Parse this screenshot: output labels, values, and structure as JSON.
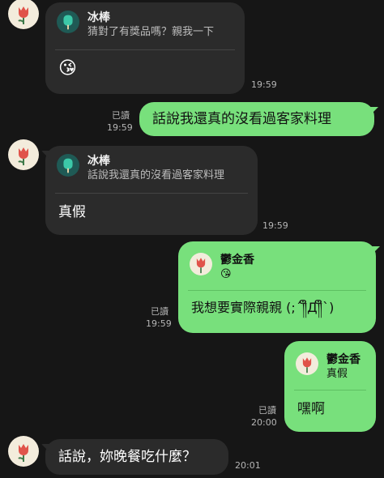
{
  "messages": {
    "m1": {
      "reply_name": "冰棒",
      "reply_text": "猜對了有獎品嗎？親我一下",
      "emoji": "😘",
      "time": "19:59"
    },
    "m2": {
      "read": "已讀",
      "text": "話說我還真的沒看過客家料理",
      "time": "19:59"
    },
    "m3": {
      "reply_name": "冰棒",
      "reply_text": "話說我還真的沒看過客家料理",
      "text": "真假",
      "time": "19:59"
    },
    "m4": {
      "read": "已讀",
      "reply_name": "鬱金香",
      "reply_text": "😘",
      "text": "我想要實際親親 (;´༎ຶД༎ຶ`)",
      "time": "19:59"
    },
    "m5": {
      "read": "已讀",
      "reply_name": "鬱金香",
      "reply_text": "真假",
      "text": "嘿啊",
      "time": "20:00"
    },
    "m6": {
      "text": "話說，妳晚餐吃什麼？",
      "time": "20:01"
    }
  },
  "colors": {
    "background": "#161616",
    "incoming_bubble": "#2b2b2b",
    "outgoing_bubble": "#78e07c",
    "avatar_bg": "#f3ecdc",
    "popsicle_icon_bg": "#1f5a55"
  },
  "icons": {
    "contact_avatar": "tulip-icon",
    "popsicle_reply_icon": "popsicle-icon"
  }
}
